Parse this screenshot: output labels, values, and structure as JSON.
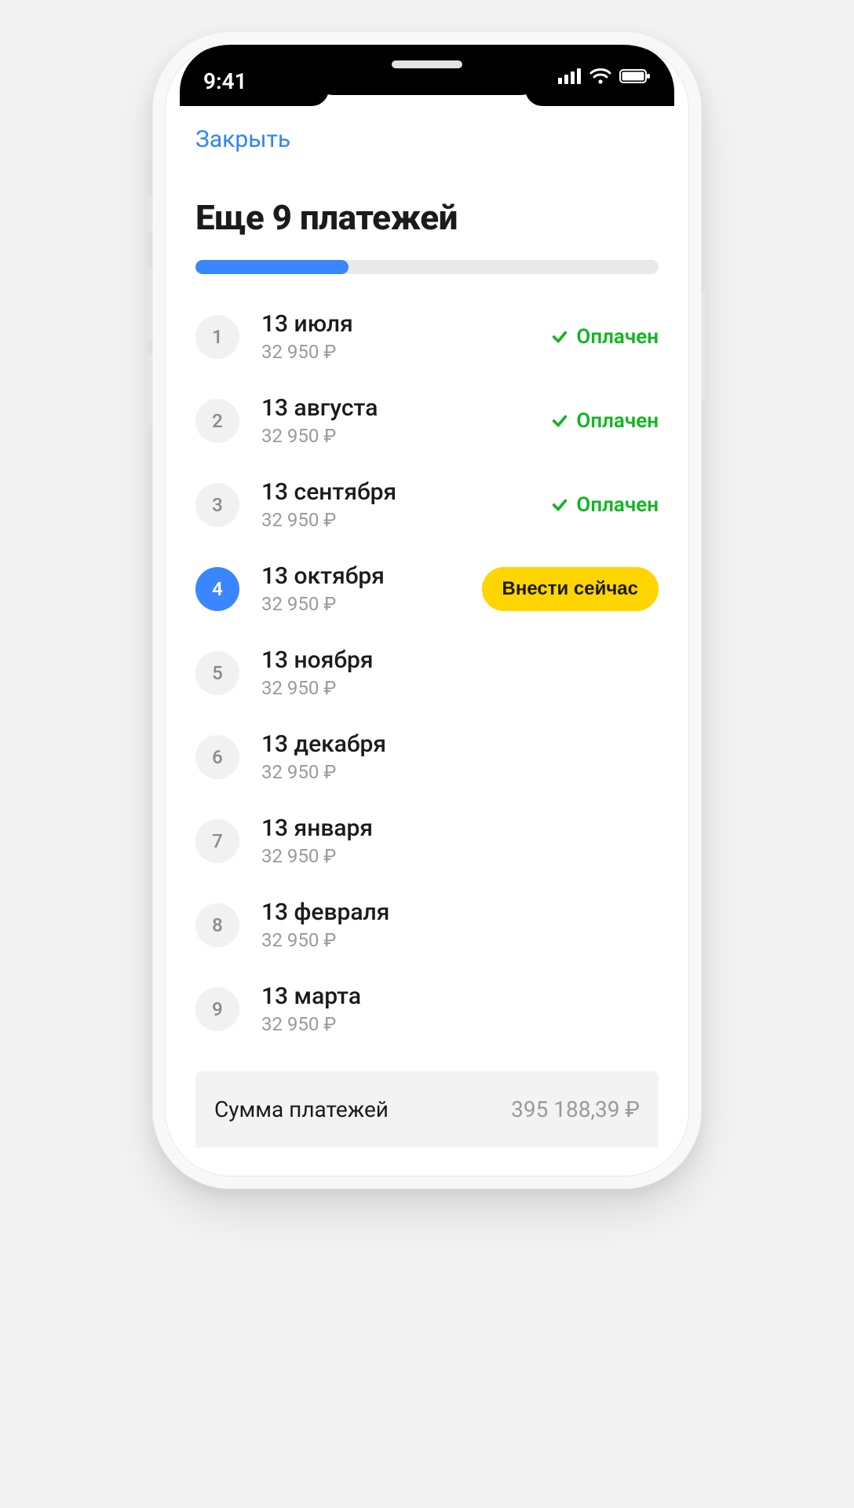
{
  "statusbar": {
    "time": "9:41"
  },
  "nav": {
    "close": "Закрыть"
  },
  "title": "Еще 9 платежей",
  "progress": {
    "percent": 33
  },
  "status_paid_label": "Оплачен",
  "pay_now_label": "Внести сейчас",
  "payments": [
    {
      "n": "1",
      "date": "13 июля",
      "amount": "32 950 ₽",
      "state": "paid"
    },
    {
      "n": "2",
      "date": "13 августа",
      "amount": "32 950 ₽",
      "state": "paid"
    },
    {
      "n": "3",
      "date": "13 сентября",
      "amount": "32 950 ₽",
      "state": "paid"
    },
    {
      "n": "4",
      "date": "13 октября",
      "amount": "32 950 ₽",
      "state": "due"
    },
    {
      "n": "5",
      "date": "13 ноября",
      "amount": "32 950 ₽",
      "state": "future"
    },
    {
      "n": "6",
      "date": "13 декабря",
      "amount": "32 950 ₽",
      "state": "future"
    },
    {
      "n": "7",
      "date": "13 января",
      "amount": "32 950 ₽",
      "state": "future"
    },
    {
      "n": "8",
      "date": "13 февраля",
      "amount": "32 950 ₽",
      "state": "future"
    },
    {
      "n": "9",
      "date": "13 марта",
      "amount": "32 950 ₽",
      "state": "future"
    }
  ],
  "total": {
    "label": "Сумма платежей",
    "amount": "395 188,39 ₽"
  },
  "colors": {
    "accent": "#3a86ff",
    "paid": "#12b521",
    "paynow_bg": "#ffd500"
  }
}
